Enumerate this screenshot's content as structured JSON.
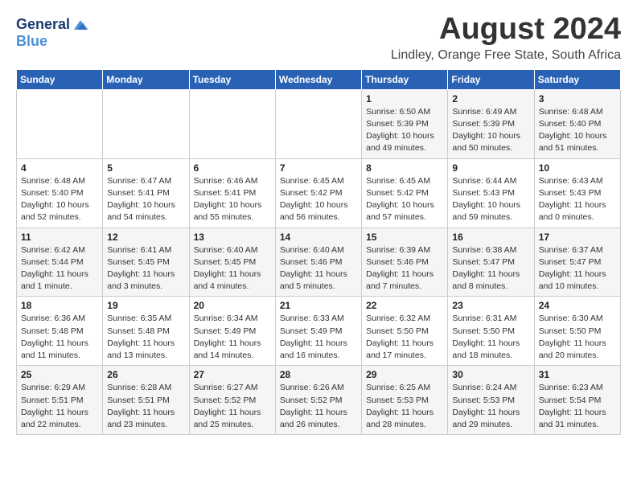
{
  "logo": {
    "line1": "General",
    "line2": "Blue"
  },
  "title": "August 2024",
  "location": "Lindley, Orange Free State, South Africa",
  "days_of_week": [
    "Sunday",
    "Monday",
    "Tuesday",
    "Wednesday",
    "Thursday",
    "Friday",
    "Saturday"
  ],
  "weeks": [
    [
      {
        "day": "",
        "info": ""
      },
      {
        "day": "",
        "info": ""
      },
      {
        "day": "",
        "info": ""
      },
      {
        "day": "",
        "info": ""
      },
      {
        "day": "1",
        "info": "Sunrise: 6:50 AM\nSunset: 5:39 PM\nDaylight: 10 hours\nand 49 minutes."
      },
      {
        "day": "2",
        "info": "Sunrise: 6:49 AM\nSunset: 5:39 PM\nDaylight: 10 hours\nand 50 minutes."
      },
      {
        "day": "3",
        "info": "Sunrise: 6:48 AM\nSunset: 5:40 PM\nDaylight: 10 hours\nand 51 minutes."
      }
    ],
    [
      {
        "day": "4",
        "info": "Sunrise: 6:48 AM\nSunset: 5:40 PM\nDaylight: 10 hours\nand 52 minutes."
      },
      {
        "day": "5",
        "info": "Sunrise: 6:47 AM\nSunset: 5:41 PM\nDaylight: 10 hours\nand 54 minutes."
      },
      {
        "day": "6",
        "info": "Sunrise: 6:46 AM\nSunset: 5:41 PM\nDaylight: 10 hours\nand 55 minutes."
      },
      {
        "day": "7",
        "info": "Sunrise: 6:45 AM\nSunset: 5:42 PM\nDaylight: 10 hours\nand 56 minutes."
      },
      {
        "day": "8",
        "info": "Sunrise: 6:45 AM\nSunset: 5:42 PM\nDaylight: 10 hours\nand 57 minutes."
      },
      {
        "day": "9",
        "info": "Sunrise: 6:44 AM\nSunset: 5:43 PM\nDaylight: 10 hours\nand 59 minutes."
      },
      {
        "day": "10",
        "info": "Sunrise: 6:43 AM\nSunset: 5:43 PM\nDaylight: 11 hours\nand 0 minutes."
      }
    ],
    [
      {
        "day": "11",
        "info": "Sunrise: 6:42 AM\nSunset: 5:44 PM\nDaylight: 11 hours\nand 1 minute."
      },
      {
        "day": "12",
        "info": "Sunrise: 6:41 AM\nSunset: 5:45 PM\nDaylight: 11 hours\nand 3 minutes."
      },
      {
        "day": "13",
        "info": "Sunrise: 6:40 AM\nSunset: 5:45 PM\nDaylight: 11 hours\nand 4 minutes."
      },
      {
        "day": "14",
        "info": "Sunrise: 6:40 AM\nSunset: 5:46 PM\nDaylight: 11 hours\nand 5 minutes."
      },
      {
        "day": "15",
        "info": "Sunrise: 6:39 AM\nSunset: 5:46 PM\nDaylight: 11 hours\nand 7 minutes."
      },
      {
        "day": "16",
        "info": "Sunrise: 6:38 AM\nSunset: 5:47 PM\nDaylight: 11 hours\nand 8 minutes."
      },
      {
        "day": "17",
        "info": "Sunrise: 6:37 AM\nSunset: 5:47 PM\nDaylight: 11 hours\nand 10 minutes."
      }
    ],
    [
      {
        "day": "18",
        "info": "Sunrise: 6:36 AM\nSunset: 5:48 PM\nDaylight: 11 hours\nand 11 minutes."
      },
      {
        "day": "19",
        "info": "Sunrise: 6:35 AM\nSunset: 5:48 PM\nDaylight: 11 hours\nand 13 minutes."
      },
      {
        "day": "20",
        "info": "Sunrise: 6:34 AM\nSunset: 5:49 PM\nDaylight: 11 hours\nand 14 minutes."
      },
      {
        "day": "21",
        "info": "Sunrise: 6:33 AM\nSunset: 5:49 PM\nDaylight: 11 hours\nand 16 minutes."
      },
      {
        "day": "22",
        "info": "Sunrise: 6:32 AM\nSunset: 5:50 PM\nDaylight: 11 hours\nand 17 minutes."
      },
      {
        "day": "23",
        "info": "Sunrise: 6:31 AM\nSunset: 5:50 PM\nDaylight: 11 hours\nand 18 minutes."
      },
      {
        "day": "24",
        "info": "Sunrise: 6:30 AM\nSunset: 5:50 PM\nDaylight: 11 hours\nand 20 minutes."
      }
    ],
    [
      {
        "day": "25",
        "info": "Sunrise: 6:29 AM\nSunset: 5:51 PM\nDaylight: 11 hours\nand 22 minutes."
      },
      {
        "day": "26",
        "info": "Sunrise: 6:28 AM\nSunset: 5:51 PM\nDaylight: 11 hours\nand 23 minutes."
      },
      {
        "day": "27",
        "info": "Sunrise: 6:27 AM\nSunset: 5:52 PM\nDaylight: 11 hours\nand 25 minutes."
      },
      {
        "day": "28",
        "info": "Sunrise: 6:26 AM\nSunset: 5:52 PM\nDaylight: 11 hours\nand 26 minutes."
      },
      {
        "day": "29",
        "info": "Sunrise: 6:25 AM\nSunset: 5:53 PM\nDaylight: 11 hours\nand 28 minutes."
      },
      {
        "day": "30",
        "info": "Sunrise: 6:24 AM\nSunset: 5:53 PM\nDaylight: 11 hours\nand 29 minutes."
      },
      {
        "day": "31",
        "info": "Sunrise: 6:23 AM\nSunset: 5:54 PM\nDaylight: 11 hours\nand 31 minutes."
      }
    ]
  ]
}
